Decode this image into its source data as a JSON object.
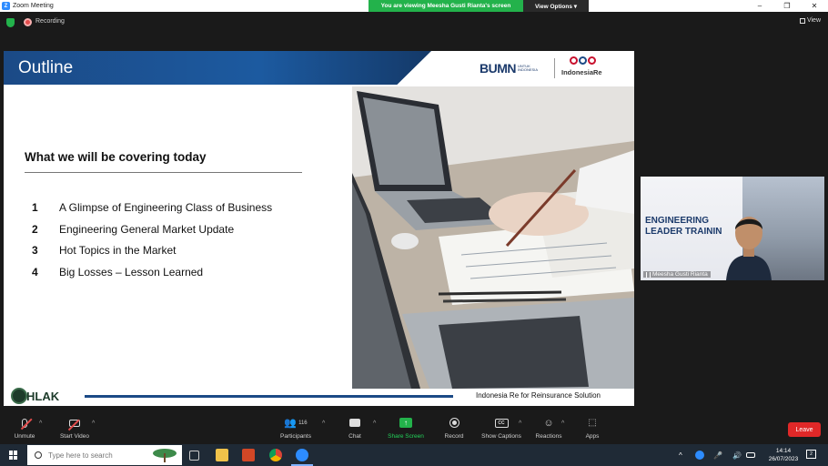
{
  "window": {
    "title": "Zoom Meeting",
    "minimize": "–",
    "restore": "❐",
    "close": "✕"
  },
  "banner": {
    "message": "You are viewing Meesha Gusti Rianta's screen",
    "view_options": "View Options ▾"
  },
  "topbar": {
    "recording_label": "Recording",
    "view_label": "View"
  },
  "slide": {
    "title": "Outline",
    "bumn_logo": "BUMN",
    "bumn_sub": "UNTUK INDONESIA",
    "ire_logo": "IndonesiaRe",
    "section_heading": "What we will be covering today",
    "agenda": [
      {
        "num": "1",
        "label": "A Glimpse of Engineering Class of Business"
      },
      {
        "num": "2",
        "label": "Engineering General Market Update"
      },
      {
        "num": "3",
        "label": "Hot Topics in the Market"
      },
      {
        "num": "4",
        "label": "Big Losses – Lesson Learned"
      }
    ],
    "footer_logo": "HLAK",
    "footer_text": "Indonesia Re for Reinsurance Solution"
  },
  "video": {
    "slide_title_1": "ENGINEERING",
    "slide_title_2": "LEADER TRAININ",
    "participant_name": "Meesha Gusti Rianta"
  },
  "toolbar": {
    "unmute": "Unmute",
    "start_video": "Start Video",
    "participants": "Participants",
    "participants_count": "116",
    "chat": "Chat",
    "share_screen": "Share Screen",
    "record": "Record",
    "show_captions": "Show Captions",
    "reactions": "Reactions",
    "apps": "Apps",
    "leave": "Leave",
    "cc": "CC"
  },
  "taskbar": {
    "search_placeholder": "Type here to search",
    "time": "14:14",
    "date": "26/07/2023",
    "notification_count": "2"
  },
  "colors": {
    "zoom_blue": "#2d8cff",
    "share_green": "#23b24b",
    "leave_red": "#e02828",
    "slide_navy": "#1b4a86"
  }
}
